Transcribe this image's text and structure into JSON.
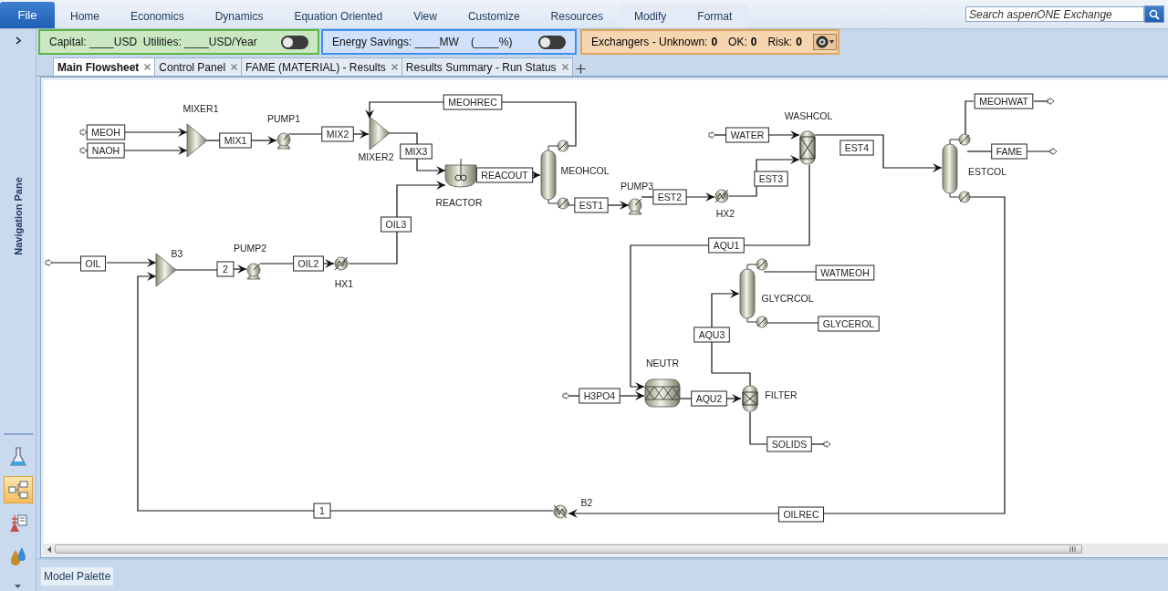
{
  "menu": {
    "file": "File",
    "tabs": [
      {
        "label": "Home",
        "selected": false,
        "kind": "normal"
      },
      {
        "label": "Economics",
        "selected": false,
        "kind": "normal"
      },
      {
        "label": "Dynamics",
        "selected": false,
        "kind": "normal"
      },
      {
        "label": "Equation Oriented",
        "selected": false,
        "kind": "normal"
      },
      {
        "label": "View",
        "selected": false,
        "kind": "normal"
      },
      {
        "label": "Customize",
        "selected": false,
        "kind": "normal"
      },
      {
        "label": "Resources",
        "selected": false,
        "kind": "normal"
      },
      {
        "label": "Modify",
        "selected": false,
        "kind": "contextual"
      },
      {
        "label": "Format",
        "selected": false,
        "kind": "contextual"
      }
    ],
    "search": {
      "placeholder": "Search aspenONE Exchange"
    }
  },
  "ribbon": {
    "panels": [
      {
        "kind": "cost",
        "text": "Capital: ____USD  Utilities: ____USD/Year",
        "toggle_on": false
      },
      {
        "kind": "energy",
        "text": "Energy Savings: ____MW    (____%)",
        "toggle_on": false
      },
      {
        "kind": "exchangers",
        "items": [
          {
            "label": "Exchangers - Unknown:",
            "value": "0"
          },
          {
            "label": "OK:",
            "value": "0"
          },
          {
            "label": "Risk:",
            "value": "0"
          }
        ]
      }
    ]
  },
  "document_tabs": [
    {
      "label": "Main Flowsheet",
      "selected": true
    },
    {
      "label": "Control Panel",
      "selected": false
    },
    {
      "label": "FAME (MATERIAL) - Results",
      "selected": false
    },
    {
      "label": "Results Summary - Run Status",
      "selected": false
    }
  ],
  "navigation_pane": {
    "title": "Navigation Pane",
    "tools": [
      {
        "selected": false
      },
      {
        "selected": true
      },
      {
        "selected": false
      },
      {
        "selected": false
      }
    ]
  },
  "flowsheet": {
    "blocks": [
      {
        "label": "MIXER1",
        "kind": "mixer"
      },
      {
        "label": "PUMP1",
        "kind": "pump"
      },
      {
        "label": "MIXER2",
        "kind": "mixer"
      },
      {
        "label": "REACTOR",
        "kind": "reactor"
      },
      {
        "label": "MEOHCOL",
        "kind": "column"
      },
      {
        "label": "PUMP3",
        "kind": "pump"
      },
      {
        "label": "HX2",
        "kind": "heater"
      },
      {
        "label": "WASHCOL",
        "kind": "decanter"
      },
      {
        "label": "ESTCOL",
        "kind": "column"
      },
      {
        "label": "B3",
        "kind": "mixer"
      },
      {
        "label": "PUMP2",
        "kind": "pump"
      },
      {
        "label": "HX1",
        "kind": "heater"
      },
      {
        "label": "GLYCRCOL",
        "kind": "column"
      },
      {
        "label": "NEUTR",
        "kind": "neutralizer"
      },
      {
        "label": "FILTER",
        "kind": "filter"
      },
      {
        "label": "B2",
        "kind": "heater"
      }
    ],
    "streams": [
      {
        "label": "MEOH"
      },
      {
        "label": "NAOH"
      },
      {
        "label": "MIX1"
      },
      {
        "label": "MIX2"
      },
      {
        "label": "MIX3"
      },
      {
        "label": "MEOHREC"
      },
      {
        "label": "REACOUT"
      },
      {
        "label": "OIL3"
      },
      {
        "label": "EST1"
      },
      {
        "label": "EST2"
      },
      {
        "label": "EST3"
      },
      {
        "label": "WATER"
      },
      {
        "label": "EST4"
      },
      {
        "label": "MEOHWAT"
      },
      {
        "label": "FAME"
      },
      {
        "label": "OIL"
      },
      {
        "label": "2"
      },
      {
        "label": "OIL2"
      },
      {
        "label": "AQU1"
      },
      {
        "label": "WATMEOH"
      },
      {
        "label": "GLYCEROL"
      },
      {
        "label": "AQU3"
      },
      {
        "label": "H3PO4"
      },
      {
        "label": "AQU2"
      },
      {
        "label": "SOLIDS"
      },
      {
        "label": "OILREC"
      },
      {
        "label": "1"
      }
    ]
  },
  "model_palette": {
    "label": "Model Palette"
  }
}
